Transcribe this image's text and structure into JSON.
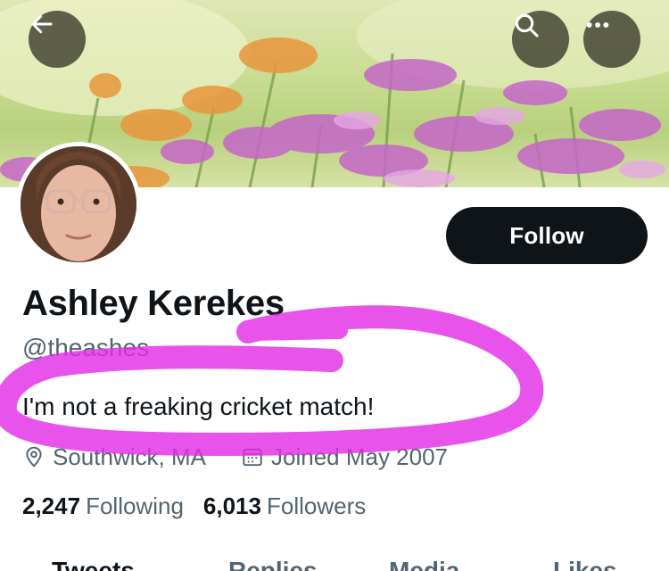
{
  "banner": {
    "back_icon": "arrow-left-icon",
    "search_icon": "search-icon",
    "more_icon": "more-horizontal-icon"
  },
  "profile": {
    "name": "Ashley Kerekes",
    "handle": "@theashes",
    "bio": "I'm not a freaking cricket match!",
    "location": "Southwick, MA",
    "joined": "Joined May 2007",
    "following_count": "2,247",
    "following_label": "Following",
    "followers_count": "6,013",
    "followers_label": "Followers"
  },
  "actions": {
    "follow_label": "Follow"
  },
  "tabs": [
    {
      "label": "Tweets",
      "active": true
    },
    {
      "label": "Replies",
      "active": false
    },
    {
      "label": "Media",
      "active": false
    },
    {
      "label": "Likes",
      "active": false
    }
  ],
  "colors": {
    "text_primary": "#0f1419",
    "text_secondary": "#536471",
    "button_dark": "#0f1419",
    "annotation": "#e32ee6"
  }
}
